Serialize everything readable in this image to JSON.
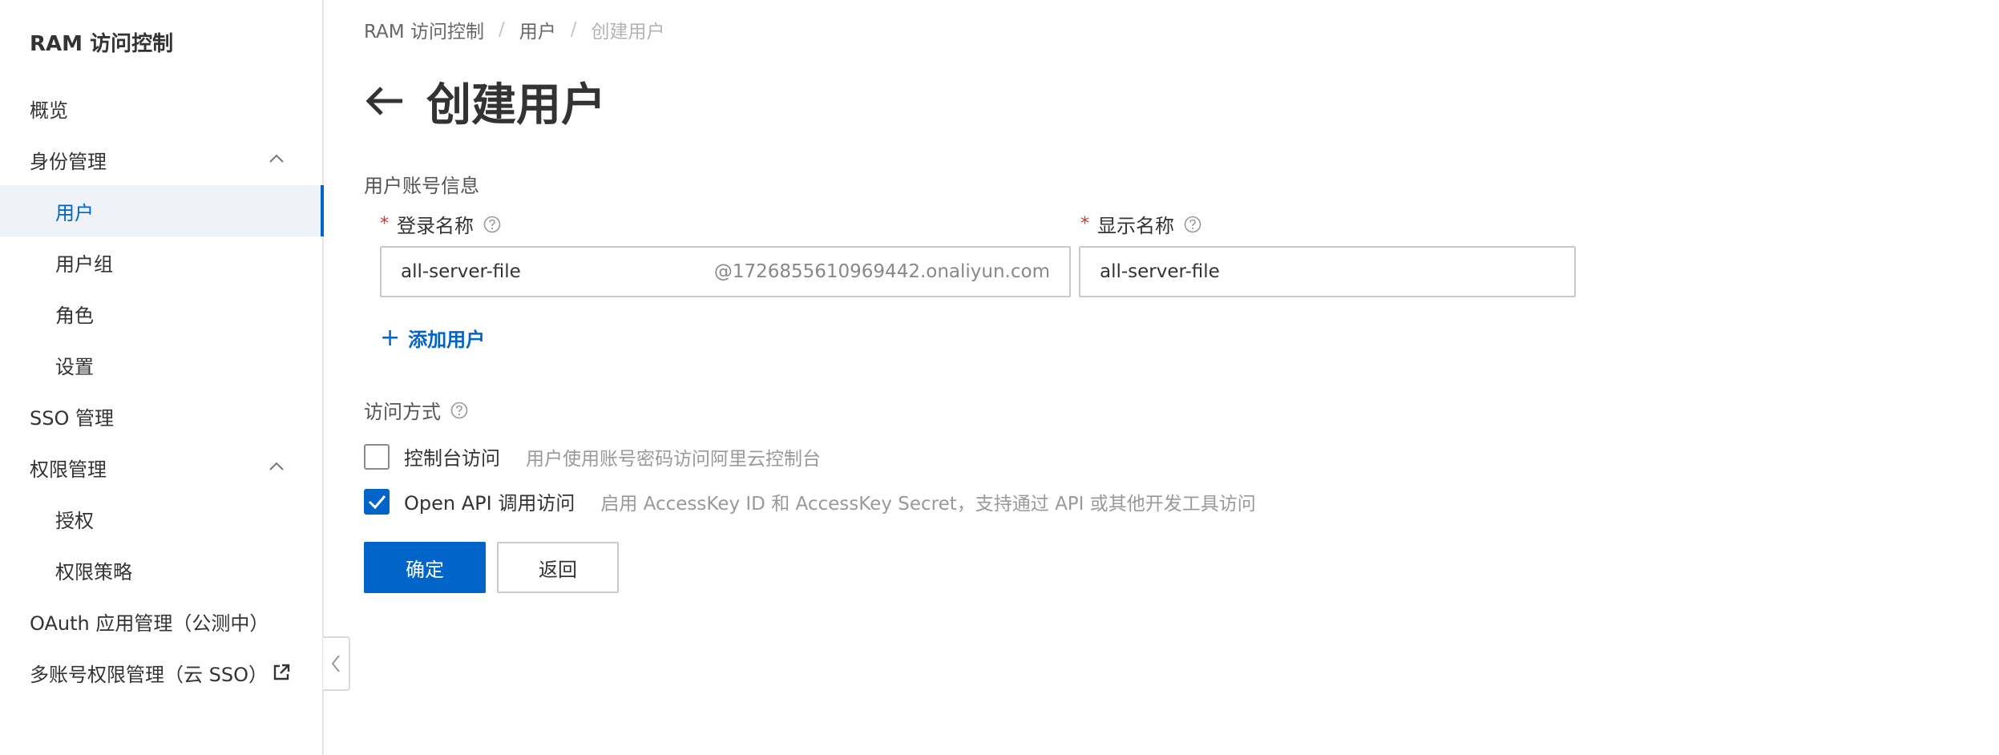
{
  "sidebar": {
    "title": "RAM 访问控制",
    "items": [
      {
        "label": "概览"
      },
      {
        "label": "身份管理"
      },
      {
        "label": "用户"
      },
      {
        "label": "用户组"
      },
      {
        "label": "角色"
      },
      {
        "label": "设置"
      },
      {
        "label": "SSO 管理"
      },
      {
        "label": "权限管理"
      },
      {
        "label": "授权"
      },
      {
        "label": "权限策略"
      },
      {
        "label": "OAuth 应用管理（公测中）"
      },
      {
        "label": "多账号权限管理（云 SSO）"
      }
    ],
    "active_item": "用户"
  },
  "breadcrumb": {
    "items": [
      "RAM 访问控制",
      "用户",
      "创建用户"
    ],
    "separator": "/"
  },
  "page": {
    "title": "创建用户"
  },
  "form": {
    "section_account": "用户账号信息",
    "login_name": {
      "label": "登录名称",
      "value": "all-server-file",
      "suffix": "@1726855610969442.onaliyun.com"
    },
    "display_name": {
      "label": "显示名称",
      "value": "all-server-file"
    },
    "add_user_label": "添加用户",
    "section_access": "访问方式",
    "access_options": [
      {
        "label": "控制台访问",
        "description": "用户使用账号密码访问阿里云控制台",
        "checked": false
      },
      {
        "label": "Open API 调用访问",
        "description": "启用 AccessKey ID 和 AccessKey Secret，支持通过 API 或其他开发工具访问",
        "checked": true
      }
    ],
    "confirm_label": "确定",
    "back_label": "返回"
  },
  "colors": {
    "accent": "#0064c8",
    "required": "#d93026",
    "active_bg": "#eff3f8"
  },
  "icons": [
    "chevron-up-icon",
    "external-link-icon",
    "chevron-left-icon",
    "back-arrow-icon",
    "help-icon",
    "plus-icon",
    "checkmark-icon"
  ]
}
